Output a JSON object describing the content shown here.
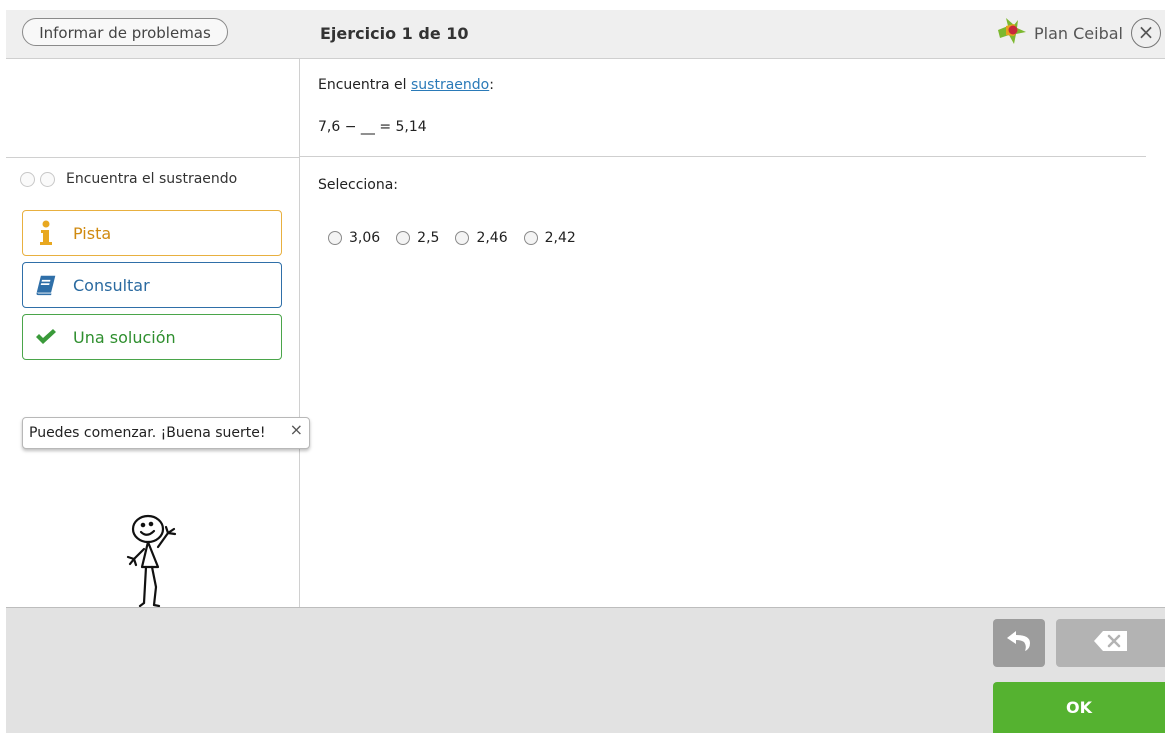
{
  "topbar": {
    "report_label": "Informar de problemas",
    "exercise_title": "Ejercicio 1 de 10",
    "brand_label": "Plan Ceibal",
    "close_symbol": "×"
  },
  "sidebar": {
    "progress_label": "Encuentra el sustraendo",
    "buttons": [
      {
        "label": "Pista",
        "icon": "info-icon"
      },
      {
        "label": "Consultar",
        "icon": "book-icon"
      },
      {
        "label": "Una solución",
        "icon": "check-icon"
      }
    ],
    "tooltip": {
      "text": "Puedes comenzar. ¡Buena suerte!",
      "close_symbol": "×"
    }
  },
  "question": {
    "prefix": "Encuentra el ",
    "link": "sustraendo",
    "suffix": ":",
    "equation": "7,6 − __ = 5,14",
    "select_label": "Selecciona:",
    "options": [
      "3,06",
      "2,5",
      "2,46",
      "2,42"
    ]
  },
  "footer": {
    "ok_label": "OK"
  },
  "colors": {
    "pista": "#d08a10",
    "consultar": "#2a6aa0",
    "solucion": "#2f8f2f",
    "ok": "#55b230"
  }
}
